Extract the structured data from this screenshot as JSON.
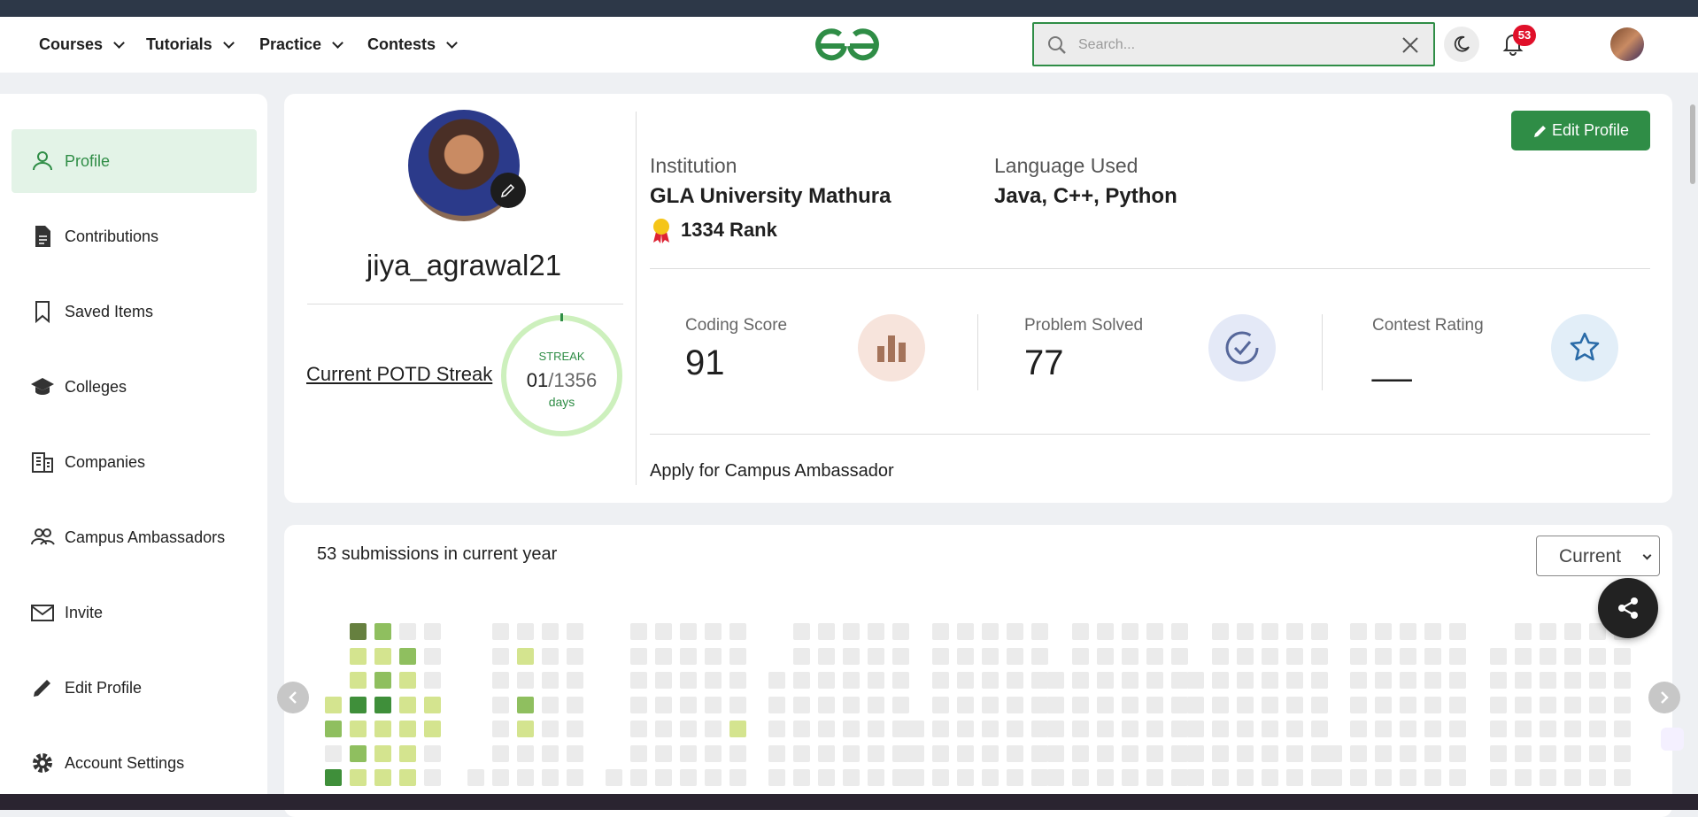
{
  "nav": {
    "items": [
      "Courses",
      "Tutorials",
      "Practice",
      "Contests"
    ],
    "search_placeholder": "Search...",
    "notification_count": "53"
  },
  "sidebar": {
    "items": [
      {
        "label": "Profile",
        "icon": "person-icon"
      },
      {
        "label": "Contributions",
        "icon": "document-icon"
      },
      {
        "label": "Saved Items",
        "icon": "bookmark-icon"
      },
      {
        "label": "Colleges",
        "icon": "graduation-cap-icon"
      },
      {
        "label": "Companies",
        "icon": "building-icon"
      },
      {
        "label": "Campus Ambassadors",
        "icon": "people-icon"
      },
      {
        "label": "Invite",
        "icon": "mail-icon"
      },
      {
        "label": "Edit Profile",
        "icon": "pencil-icon"
      },
      {
        "label": "Account Settings",
        "icon": "gear-icon"
      }
    ]
  },
  "profile": {
    "username": "jiya_agrawal21",
    "potd_label": "Current POTD Streak",
    "streak_title": "STREAK",
    "streak_current": "01",
    "streak_total": "/1356",
    "streak_unit": "days",
    "edit_button": "Edit Profile",
    "institution_label": "Institution",
    "institution": "GLA University Mathura",
    "rank": "1334 Rank",
    "language_label": "Language Used",
    "languages": "Java, C++, Python",
    "stats": [
      {
        "label": "Coding Score",
        "value": "91"
      },
      {
        "label": "Problem Solved",
        "value": "77"
      },
      {
        "label": "Contest Rating",
        "value": "__"
      }
    ],
    "ambassador_link": "Apply for Campus Ambassador"
  },
  "submissions": {
    "title": "53 submissions in current year",
    "year_select": "Current"
  },
  "colors": {
    "brand": "#2f8d46",
    "heat_low": "#d4e48f",
    "heat_mid": "#8fbf5f",
    "heat_high": "#3f8f3a",
    "heat_empty": "#ebebeb"
  }
}
